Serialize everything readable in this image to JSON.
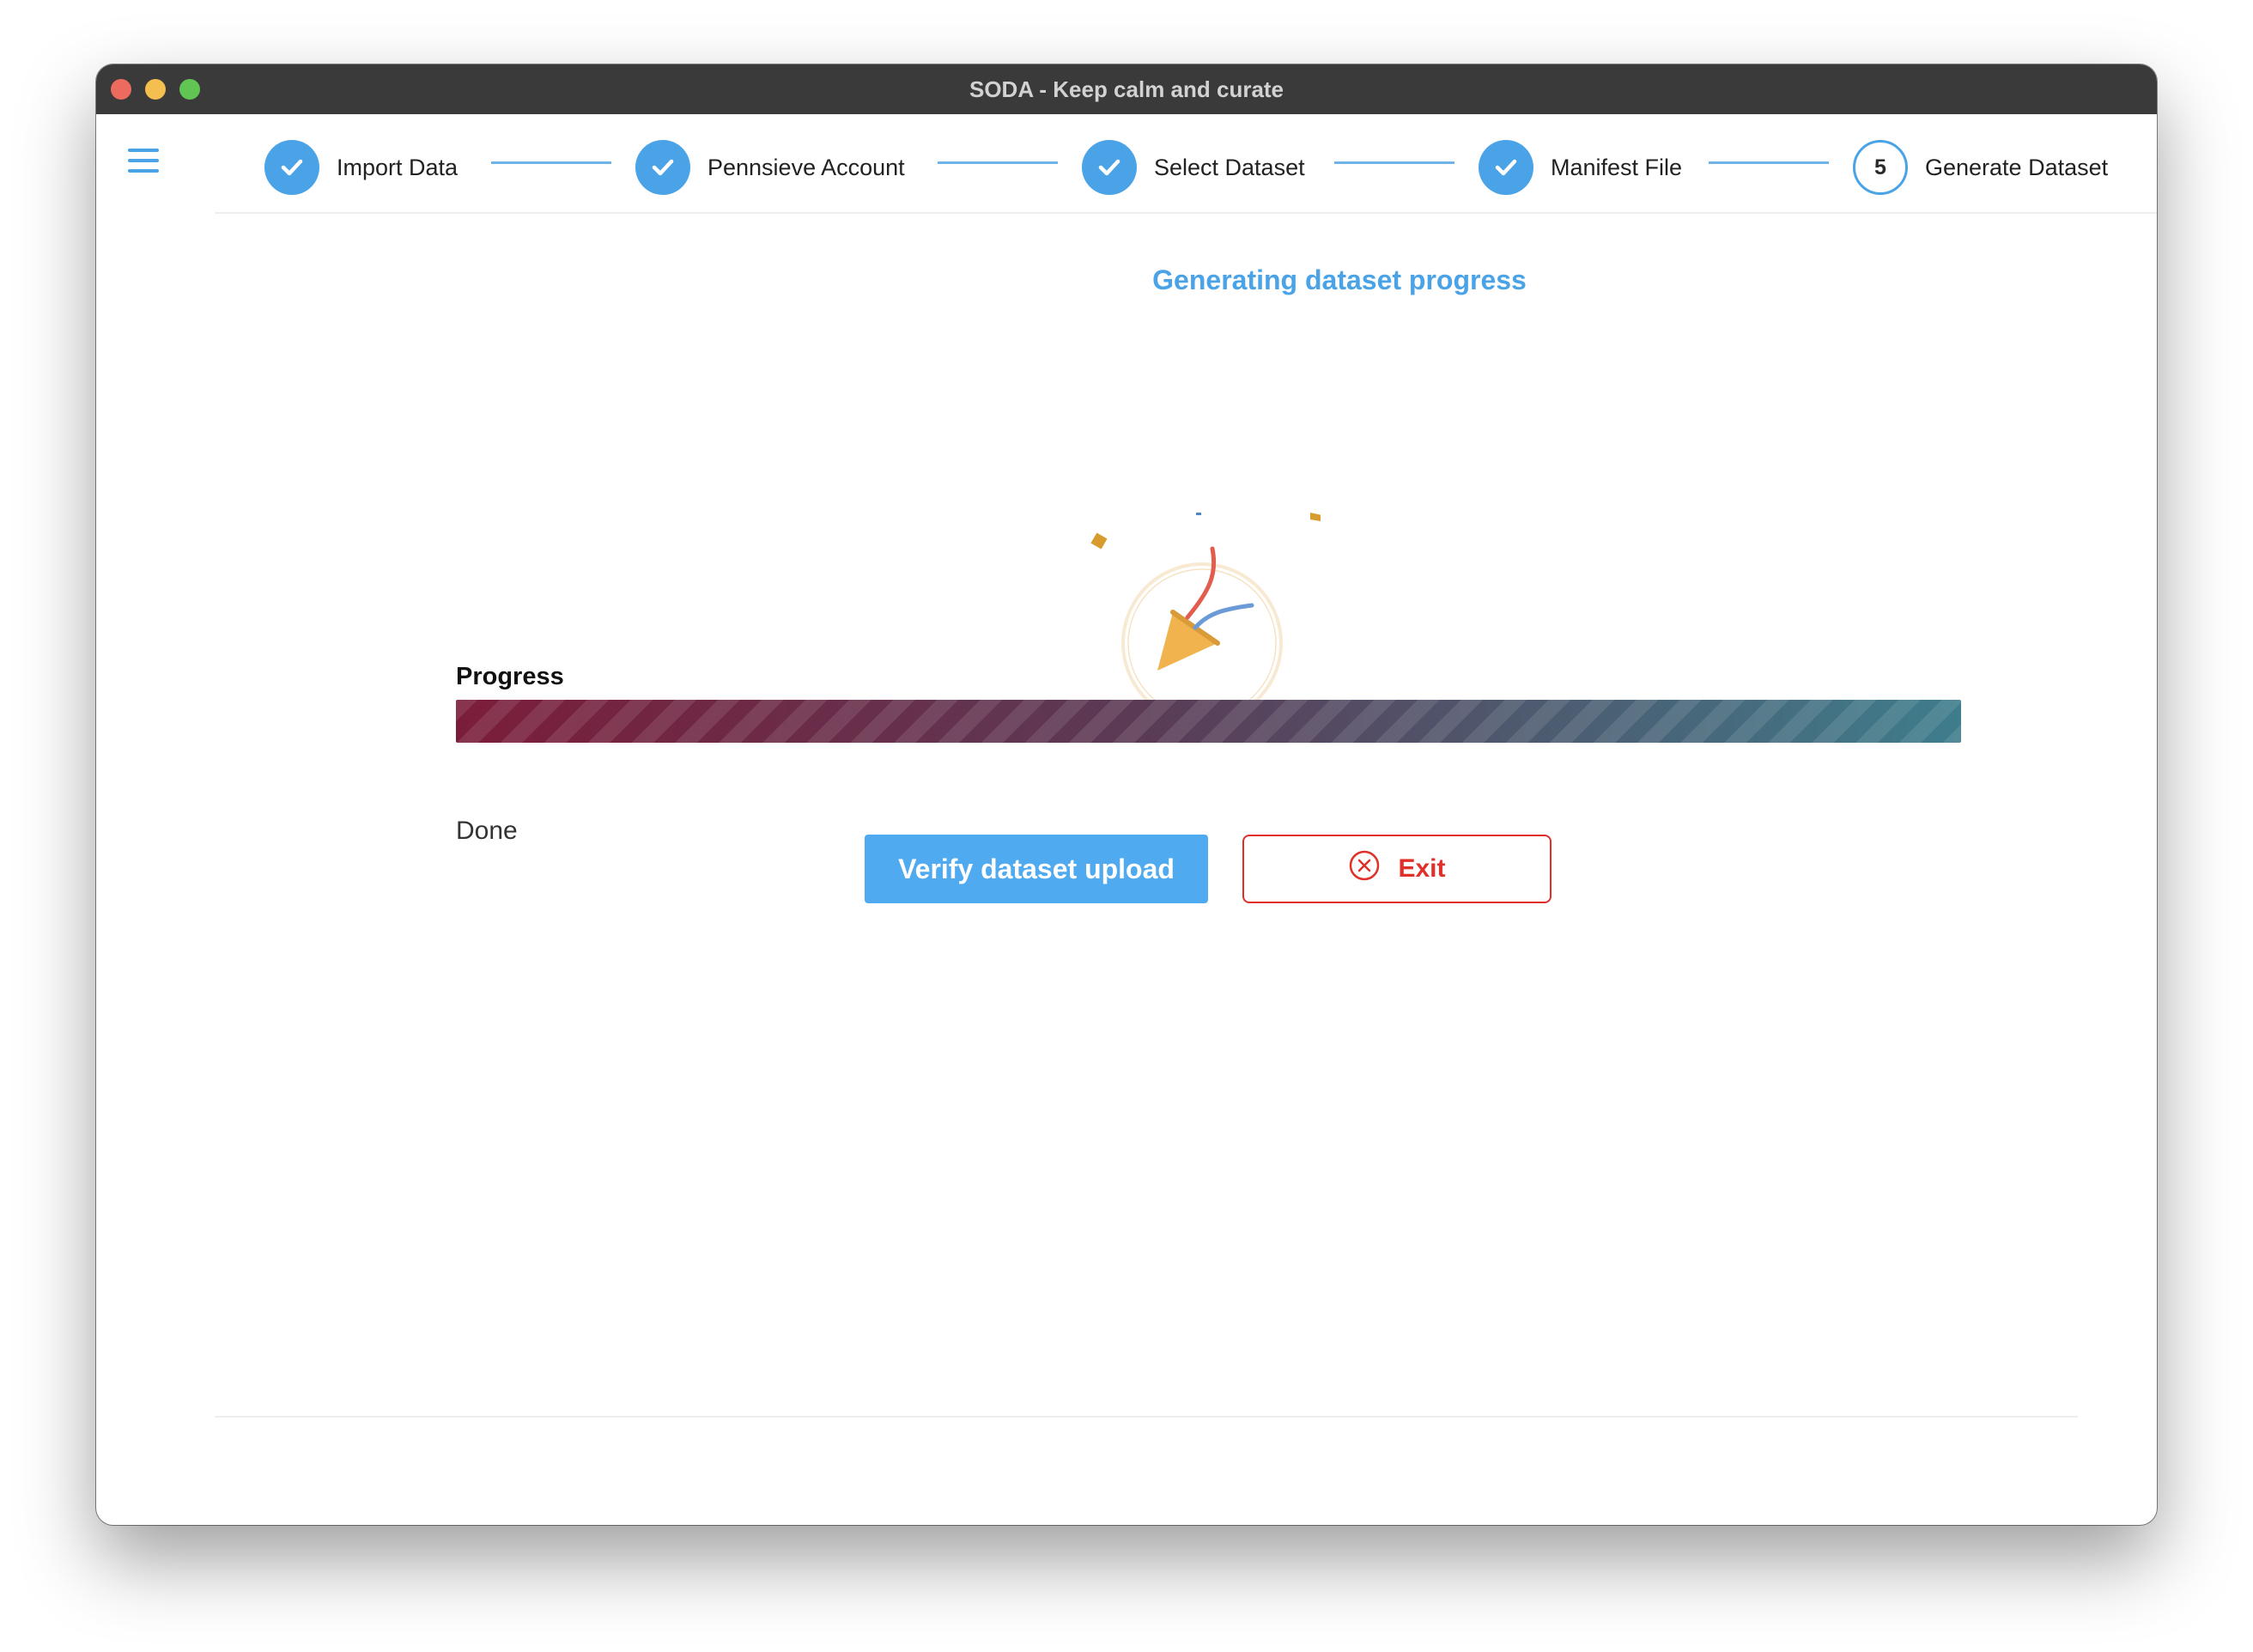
{
  "window": {
    "title": "SODA - Keep calm and curate"
  },
  "icons": {
    "menu": "hamburger-menu-icon",
    "completed_step": "checkmark-icon",
    "celebration": "party-popper-icon",
    "exit": "circle-x-icon"
  },
  "steps": [
    {
      "label": "Import Data",
      "state": "complete"
    },
    {
      "label": "Pennsieve Account",
      "state": "complete"
    },
    {
      "label": "Select Dataset",
      "state": "complete"
    },
    {
      "label": "Manifest File",
      "state": "complete"
    },
    {
      "label": "Generate Dataset",
      "state": "current",
      "number": "5"
    }
  ],
  "main": {
    "heading": "Generating dataset progress",
    "progress_label": "Progress",
    "progress_value": 1.0,
    "status": "Done"
  },
  "actions": {
    "verify_label": "Verify dataset upload",
    "exit_label": "Exit"
  },
  "colors": {
    "accent": "#4aa3e6",
    "danger": "#e0302a",
    "progress_start": "#7b1d3a",
    "progress_end": "#3e7d8c"
  }
}
